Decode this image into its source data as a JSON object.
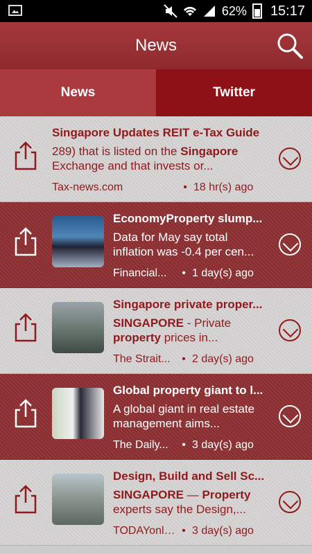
{
  "status": {
    "battery": "62%",
    "time": "15:17"
  },
  "appbar": {
    "title": "News"
  },
  "tabs": [
    {
      "label": "News",
      "active": true
    },
    {
      "label": "Twitter",
      "active": false
    }
  ],
  "items": [
    {
      "title": "Singapore Updates REIT e-Tax Guide",
      "snippet_plain1": "289) that is listed on the ",
      "snippet_bold1": "Singapore",
      "snippet_plain2": " Exchange and that invests or...",
      "snippet_bold2": "",
      "source": "Tax-news.com",
      "dot": "•",
      "time": "18 hr(s) ago",
      "has_thumb": false
    },
    {
      "title": "EconomyProperty slump...",
      "snippet_plain1": "Data for May say total inflation was -0.4 per cen...",
      "snippet_bold1": "",
      "snippet_plain2": "",
      "snippet_bold2": "",
      "source": "Financial...",
      "dot": "•",
      "time": "1 day(s) ago",
      "has_thumb": true
    },
    {
      "title": "Singapore private proper...",
      "snippet_plain1": "",
      "snippet_bold1": "SINGAPORE",
      "snippet_plain2": " - Private ",
      "snippet_bold2": "property",
      "snippet_plain3": " prices in...",
      "source": "The Strait...",
      "dot": "•",
      "time": "2 day(s) ago",
      "has_thumb": true
    },
    {
      "title": "Global property giant to l...",
      "snippet_plain1": "A global giant in real estate management aims...",
      "snippet_bold1": "",
      "snippet_plain2": "",
      "snippet_bold2": "",
      "source": "The Daily...",
      "dot": "•",
      "time": "3 day(s) ago",
      "has_thumb": true
    },
    {
      "title": "Design, Build and Sell Sc...",
      "snippet_plain1": "",
      "snippet_bold1": "SINGAPORE",
      "snippet_plain2": " — ",
      "snippet_bold2": "Property",
      "snippet_plain3": " experts say the Design,...",
      "source": "TODAYonli...",
      "dot": "•",
      "time": "3 day(s) ago",
      "has_thumb": true
    }
  ]
}
